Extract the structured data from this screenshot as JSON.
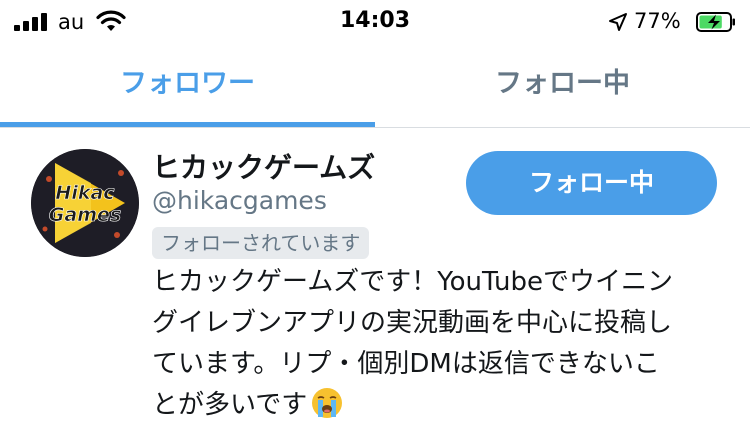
{
  "status_bar": {
    "carrier": "au",
    "time": "14:03",
    "battery_percent": "77%",
    "battery_level": 0.77,
    "charging": true,
    "icons": [
      "signal-icon",
      "wifi-icon",
      "location-arrow-icon",
      "battery-charging-icon"
    ]
  },
  "tabs": [
    {
      "label": "フォロワー",
      "active": true
    },
    {
      "label": "フォロー中",
      "active": false
    }
  ],
  "colors": {
    "accent": "#4a9ee8",
    "secondary_text": "#657786",
    "badge_bg": "#e7eaed",
    "battery_green": "#4cd964"
  },
  "user": {
    "avatar_text_1": "Hikac",
    "avatar_text_2": "Games",
    "name": "ヒカックゲームズ",
    "handle": "@hikacgames",
    "follows_you": "フォローされています",
    "follow_button": "フォロー中",
    "bio_lines": [
      "ヒカックゲームズです！YouTubeでウイニン",
      "グイレブンアプリの実況動画を中心に投稿し",
      "ています。リプ・個別DMは返信できないこ",
      "とが多いです"
    ],
    "bio_emoji": "loudly-crying-face"
  }
}
